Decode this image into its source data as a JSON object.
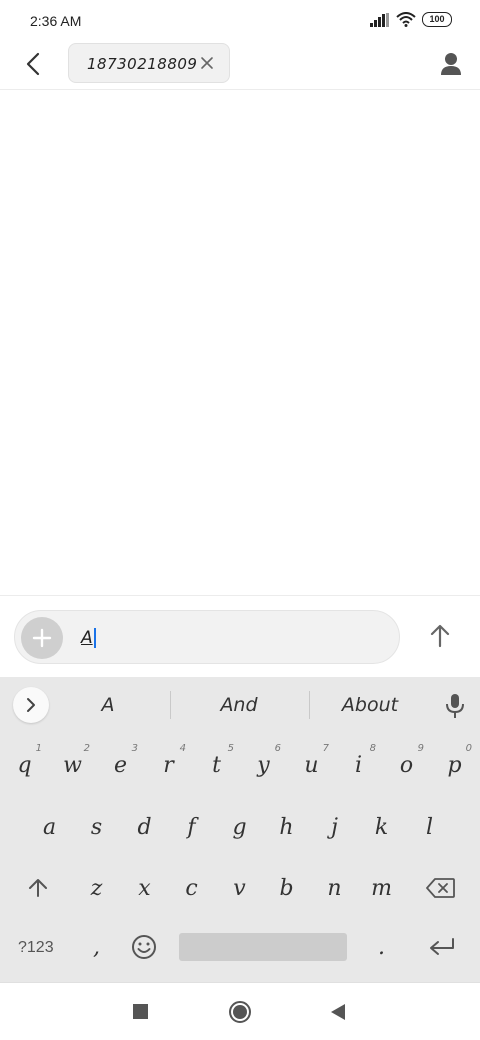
{
  "status_bar": {
    "time": "2:36 AM",
    "battery": "100"
  },
  "header": {
    "recipient": "18730218809"
  },
  "compose": {
    "text": "A"
  },
  "keyboard": {
    "suggestions": [
      "A",
      "And",
      "About"
    ],
    "row1": [
      {
        "char": "q",
        "hint": "1"
      },
      {
        "char": "w",
        "hint": "2"
      },
      {
        "char": "e",
        "hint": "3"
      },
      {
        "char": "r",
        "hint": "4"
      },
      {
        "char": "t",
        "hint": "5"
      },
      {
        "char": "y",
        "hint": "6"
      },
      {
        "char": "u",
        "hint": "7"
      },
      {
        "char": "i",
        "hint": "8"
      },
      {
        "char": "o",
        "hint": "9"
      },
      {
        "char": "p",
        "hint": "0"
      }
    ],
    "row2": [
      "a",
      "s",
      "d",
      "f",
      "g",
      "h",
      "j",
      "k",
      "l"
    ],
    "row3": [
      "z",
      "x",
      "c",
      "v",
      "b",
      "n",
      "m"
    ],
    "row4": {
      "symbols": "?123",
      "comma": ",",
      "period": "."
    }
  },
  "colors": {
    "cursor": "#1a73e8",
    "keyboard_bg": "#e8e8e8"
  }
}
